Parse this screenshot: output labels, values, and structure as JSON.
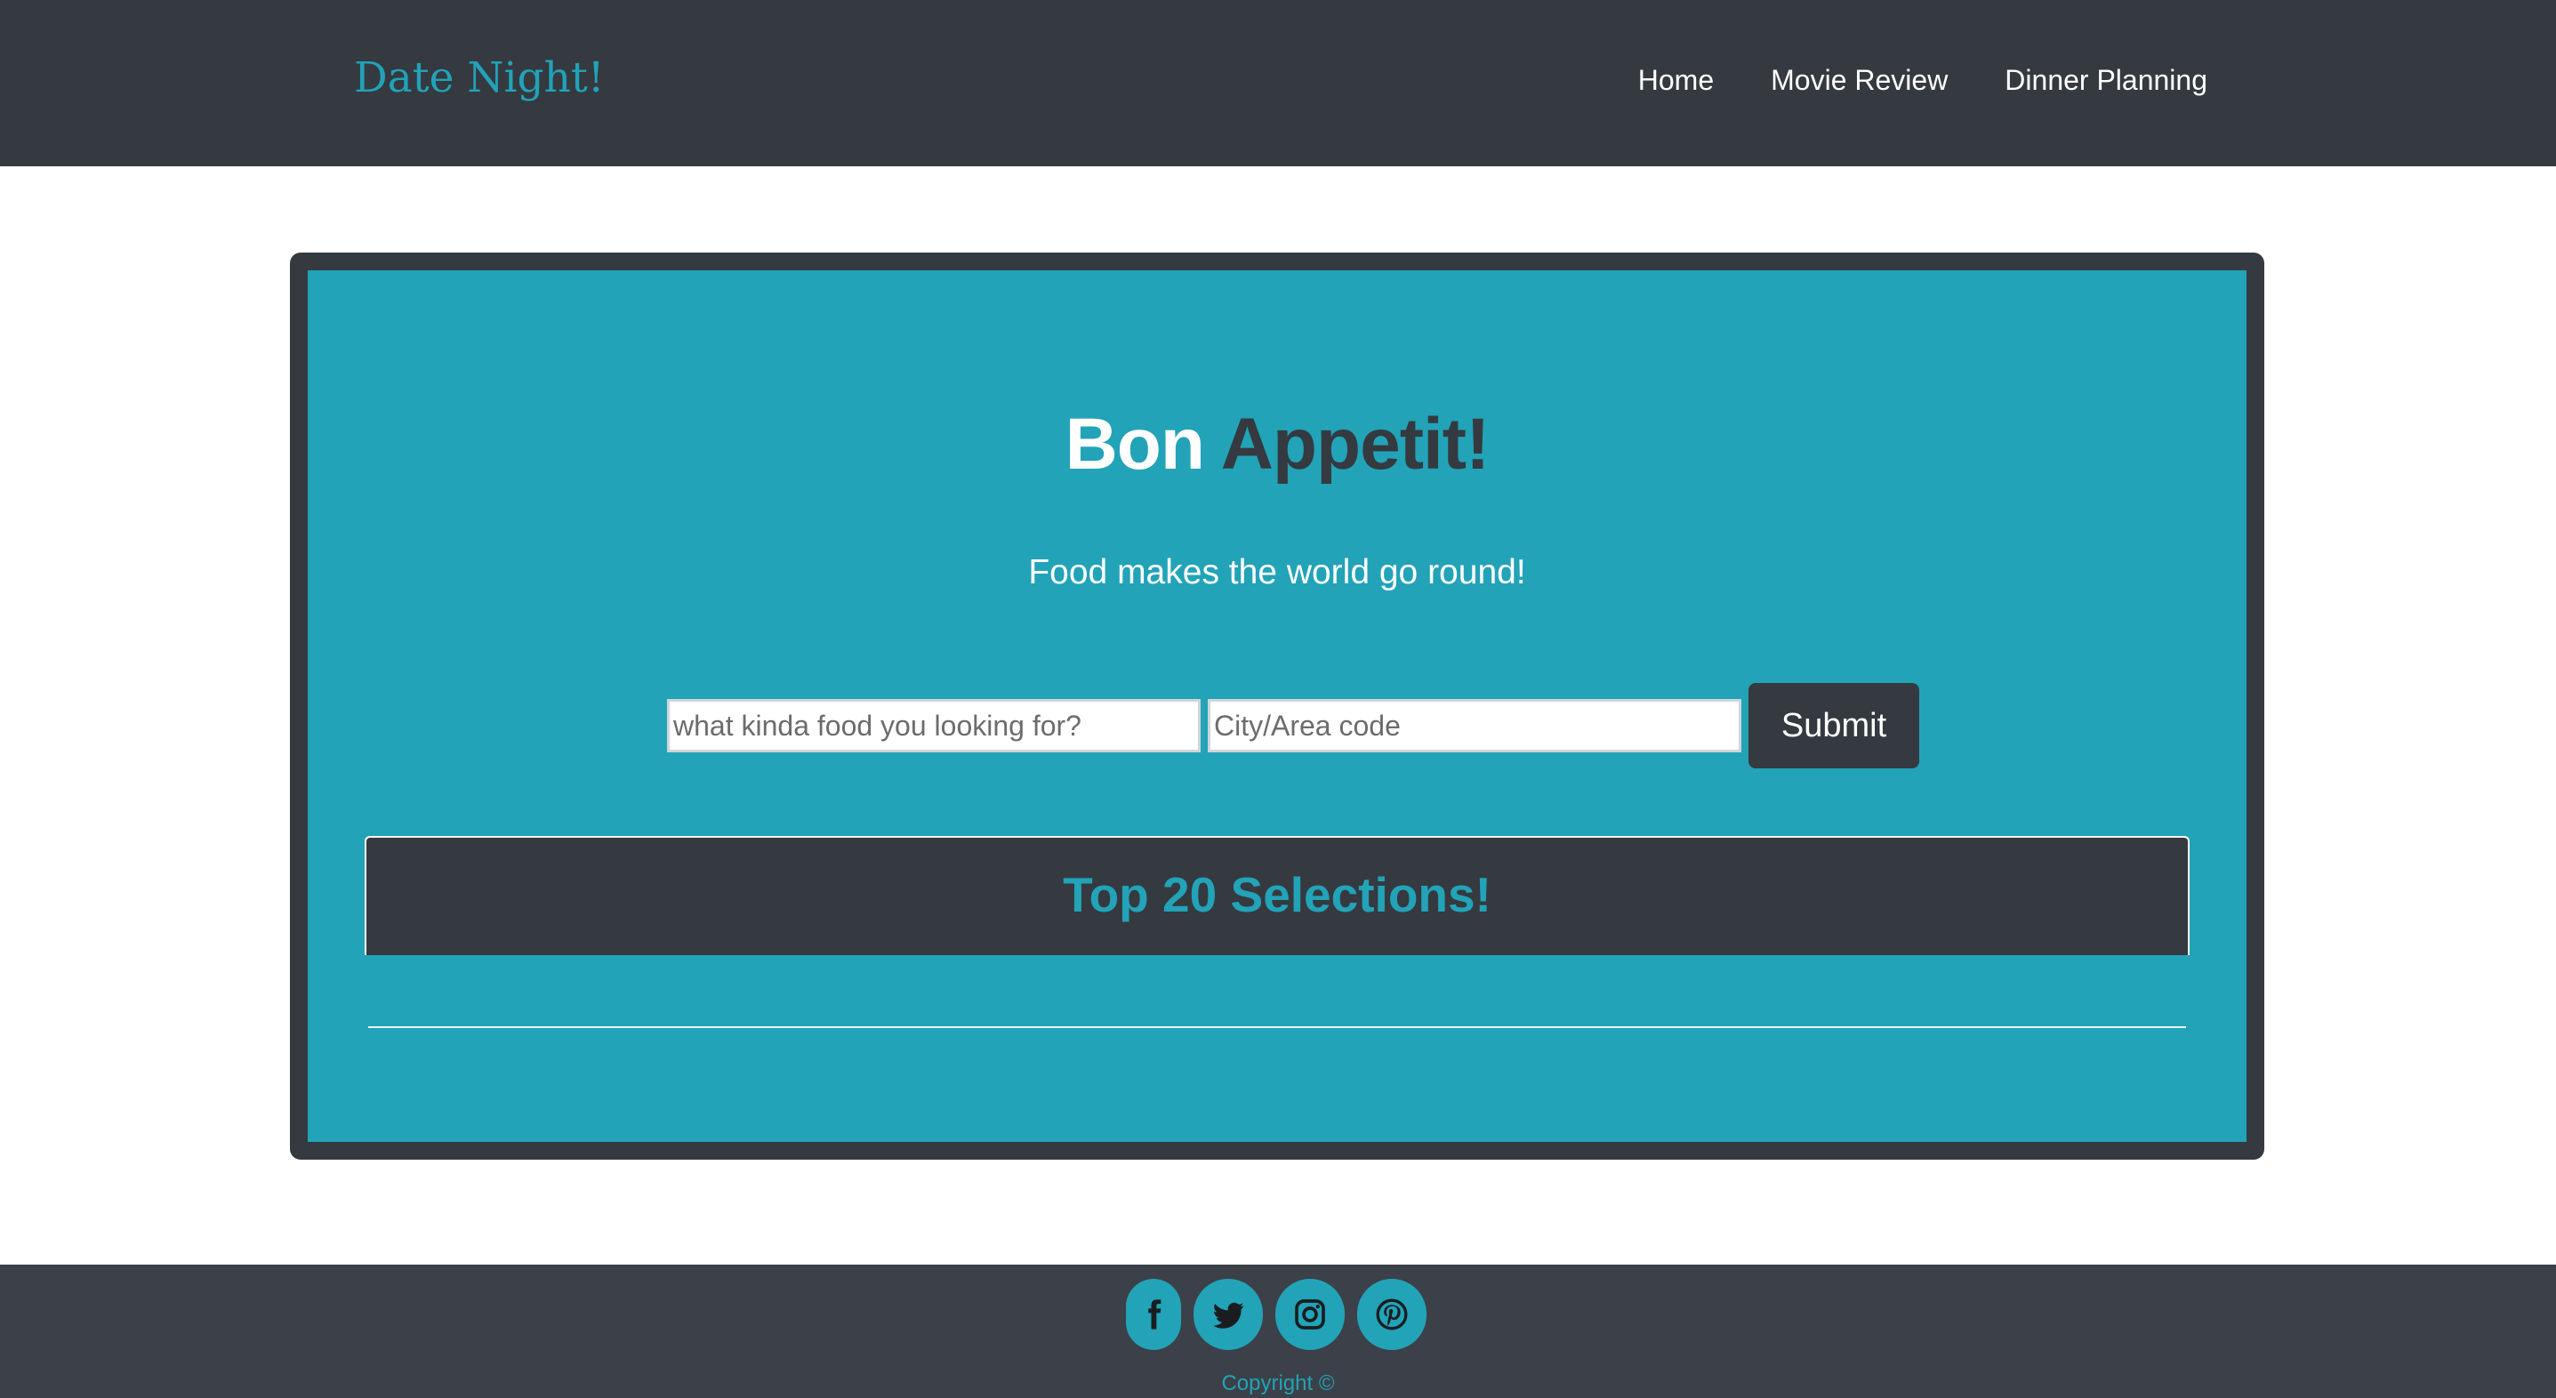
{
  "navbar": {
    "brand": "Date Night!",
    "links": [
      {
        "label": "Home"
      },
      {
        "label": "Movie Review"
      },
      {
        "label": "Dinner Planning"
      }
    ]
  },
  "hero": {
    "heading_part1": "Bon",
    "heading_part2": "Appetit!",
    "tagline": "Food makes the world go round!"
  },
  "search": {
    "food_placeholder": "what kinda food you looking for?",
    "food_value": "",
    "location_placeholder": "City/Area code",
    "location_value": "",
    "submit_label": "Submit"
  },
  "results": {
    "title": "Top 20 Selections!"
  },
  "footer": {
    "social_icons": [
      "facebook-icon",
      "twitter-icon",
      "instagram-icon",
      "pinterest-icon"
    ],
    "copyright": "Copyright ©"
  },
  "colors": {
    "accent": "#22a3b8",
    "dark": "#343a40",
    "footer_bg": "#3c4048",
    "white": "#ffffff"
  }
}
